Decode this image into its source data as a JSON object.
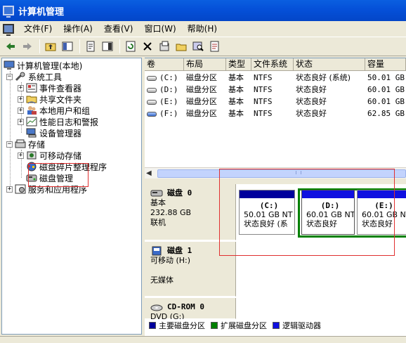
{
  "window": {
    "title": "计算机管理"
  },
  "menu": [
    "文件(F)",
    "操作(A)",
    "查看(V)",
    "窗口(W)",
    "帮助(H)"
  ],
  "toolbar": [
    "back-arrow-icon",
    "forward-arrow-icon",
    "up-folder-icon",
    "show-tree-icon",
    "properties-icon",
    "help-icon",
    "refresh-icon",
    "delete-icon",
    "properties-2-icon",
    "open-icon",
    "search-icon",
    "export-icon"
  ],
  "tree": {
    "root": "计算机管理(本地)",
    "system_tools": "系统工具",
    "event_viewer": "事件查看器",
    "shared_folders": "共享文件夹",
    "local_users": "本地用户和组",
    "perf_logs": "性能日志和警报",
    "device_manager": "设备管理器",
    "storage": "存储",
    "removable_storage": "可移动存储",
    "defrag": "磁盘碎片整理程序",
    "disk_mgmt": "磁盘管理",
    "services_apps": "服务和应用程序"
  },
  "list": {
    "columns": [
      "卷",
      "布局",
      "类型",
      "文件系统",
      "状态",
      "容量"
    ],
    "rows": [
      {
        "vol": "(C:)",
        "layout": "磁盘分区",
        "type": "基本",
        "fs": "NTFS",
        "status": "状态良好 (系统)",
        "cap": "50.01 GB"
      },
      {
        "vol": "(D:)",
        "layout": "磁盘分区",
        "type": "基本",
        "fs": "NTFS",
        "status": "状态良好",
        "cap": "60.01 GB"
      },
      {
        "vol": "(E:)",
        "layout": "磁盘分区",
        "type": "基本",
        "fs": "NTFS",
        "status": "状态良好",
        "cap": "60.01 GB"
      },
      {
        "vol": "(F:)",
        "layout": "磁盘分区",
        "type": "基本",
        "fs": "NTFS",
        "status": "状态良好",
        "cap": "62.85 GB"
      }
    ]
  },
  "disks": {
    "disk0": {
      "title": "磁盘 0",
      "type": "基本",
      "size": "232.88 GB",
      "state": "联机"
    },
    "disk1": {
      "title": "磁盘 1",
      "type": "可移动 (H:)",
      "media": "无媒体"
    },
    "cdrom": {
      "title": "CD-ROM 0",
      "type": "DVD (G:)"
    }
  },
  "partitions": [
    {
      "name": "(C:)",
      "size": "50.01 GB NT",
      "status": "状态良好 (系"
    },
    {
      "name": "(D:)",
      "size": "60.01 GB NT",
      "status": "状态良好"
    },
    {
      "name": "(E:)",
      "size": "60.01 GB NT",
      "status": "状态良好"
    }
  ],
  "legend": [
    {
      "label": "主要磁盘分区",
      "color": "#00009c"
    },
    {
      "label": "扩展磁盘分区",
      "color": "#008000"
    },
    {
      "label": "逻辑驱动器",
      "color": "#1010e0"
    }
  ]
}
